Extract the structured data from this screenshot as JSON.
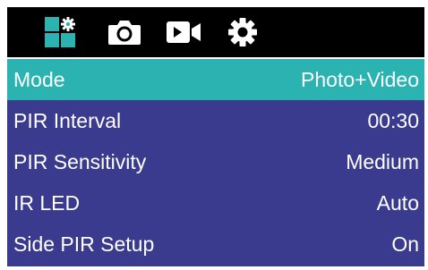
{
  "tabs": [
    {
      "name": "mode-settings-icon",
      "active": true
    },
    {
      "name": "camera-icon",
      "active": false
    },
    {
      "name": "video-icon",
      "active": false
    },
    {
      "name": "gear-icon",
      "active": false
    }
  ],
  "colors": {
    "tabbar_bg": "#000000",
    "active_tab": "#2bb3b2",
    "icon": "#ffffff",
    "menu_bg": "#3a3a8e",
    "selected_row": "#2bb3b2"
  },
  "menu": {
    "items": [
      {
        "label": "Mode",
        "value": "Photo+Video",
        "selected": true
      },
      {
        "label": "PIR Interval",
        "value": "00:30",
        "selected": false
      },
      {
        "label": "PIR Sensitivity",
        "value": "Medium",
        "selected": false
      },
      {
        "label": "IR LED",
        "value": "Auto",
        "selected": false
      },
      {
        "label": "Side PIR Setup",
        "value": "On",
        "selected": false
      }
    ]
  }
}
